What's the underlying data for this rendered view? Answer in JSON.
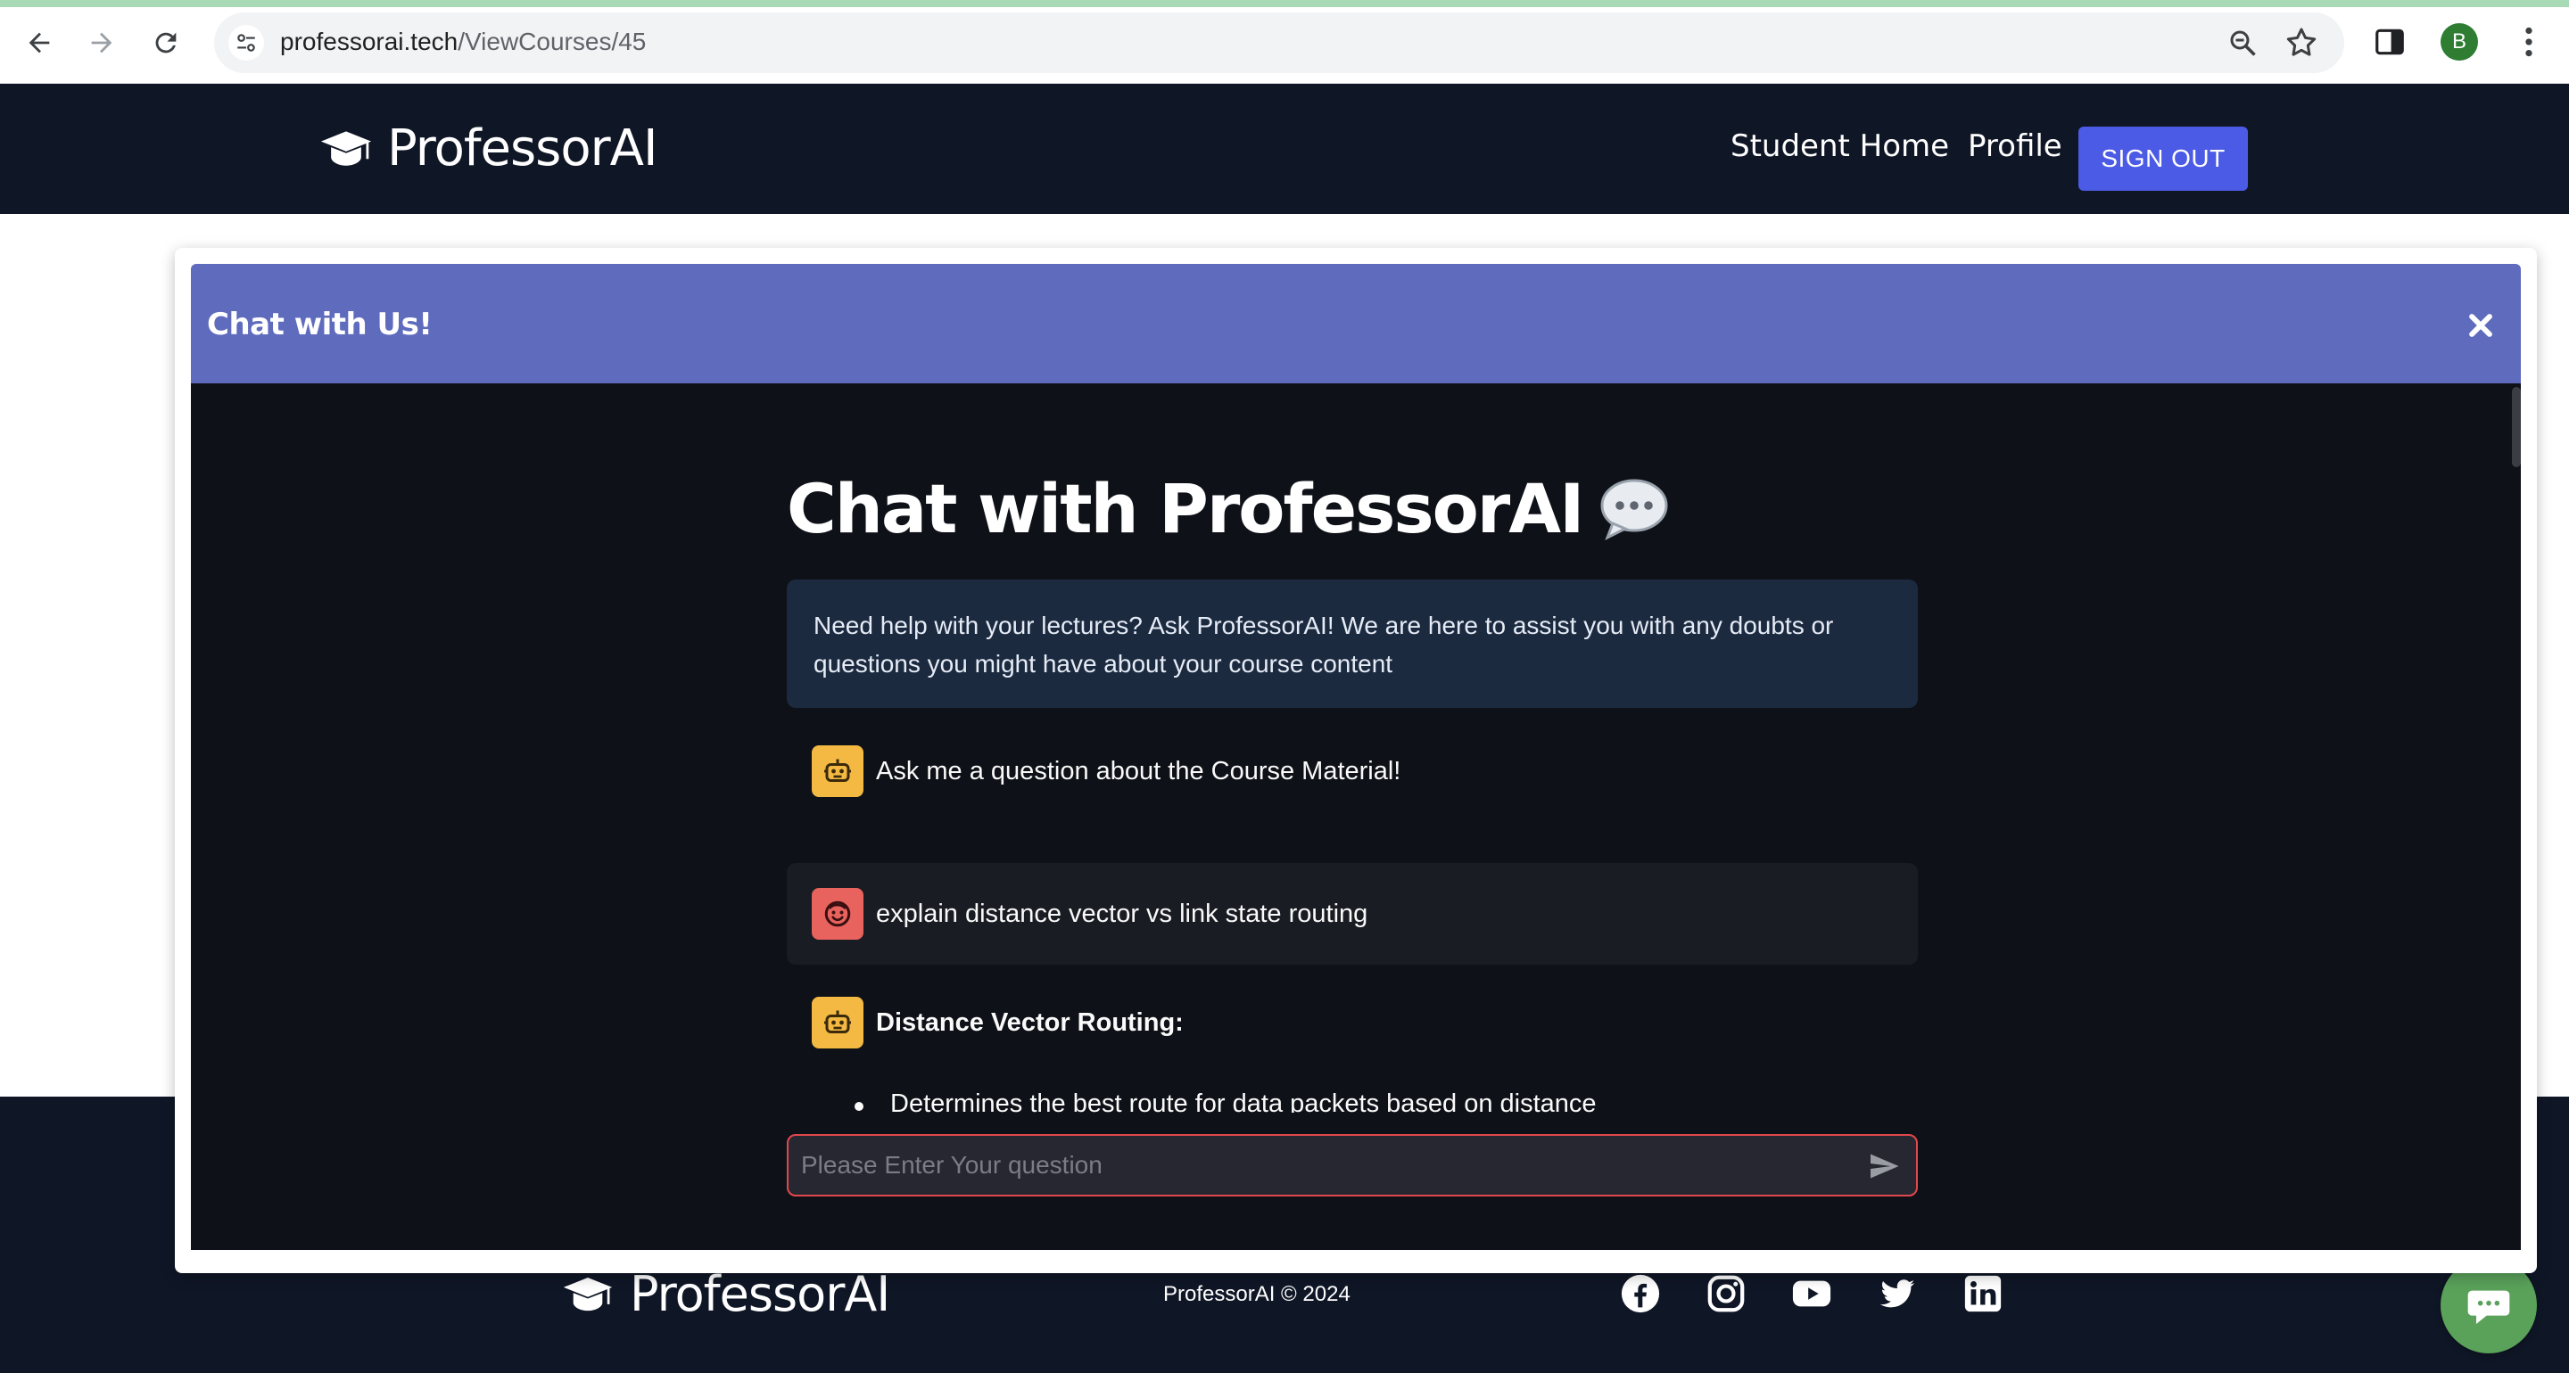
{
  "browser": {
    "url_host": "professorai.tech",
    "url_path": "/ViewCourses/45",
    "profile_initial": "B"
  },
  "header": {
    "brand": "ProfessorAI",
    "nav": [
      {
        "label": "Student Home"
      },
      {
        "label": "Profile"
      }
    ],
    "signout_label": "SIGN OUT"
  },
  "modal": {
    "title": "Chat with Us!",
    "chat": {
      "heading": "Chat with ProfessorAI",
      "intro": "Need help with your lectures? Ask ProfessorAI! We are here to assist you with any doubts or questions you might have about your course content",
      "messages": [
        {
          "role": "assistant",
          "text": "Ask me a question about the Course Material!"
        },
        {
          "role": "user",
          "text": "explain distance vector vs link state routing"
        },
        {
          "role": "assistant",
          "text": "Distance Vector Routing:",
          "bullets": [
            "Determines the best route for data packets based on distance"
          ]
        }
      ],
      "input_placeholder": "Please Enter Your question"
    }
  },
  "footer": {
    "brand": "ProfessorAI",
    "copyright": "ProfessorAI © 2024",
    "socials": [
      "facebook-icon",
      "instagram-icon",
      "youtube-icon",
      "twitter-icon",
      "linkedin-icon"
    ]
  },
  "colors": {
    "header_bg": "#0f1626",
    "modal_header": "#5f6bbd",
    "signout": "#4c5be6",
    "chat_bg": "#0e1117",
    "bot_avatar": "#f3b942",
    "user_avatar": "#e8625e",
    "input_border": "#e2474d",
    "chat_fab": "#5aa15a"
  }
}
